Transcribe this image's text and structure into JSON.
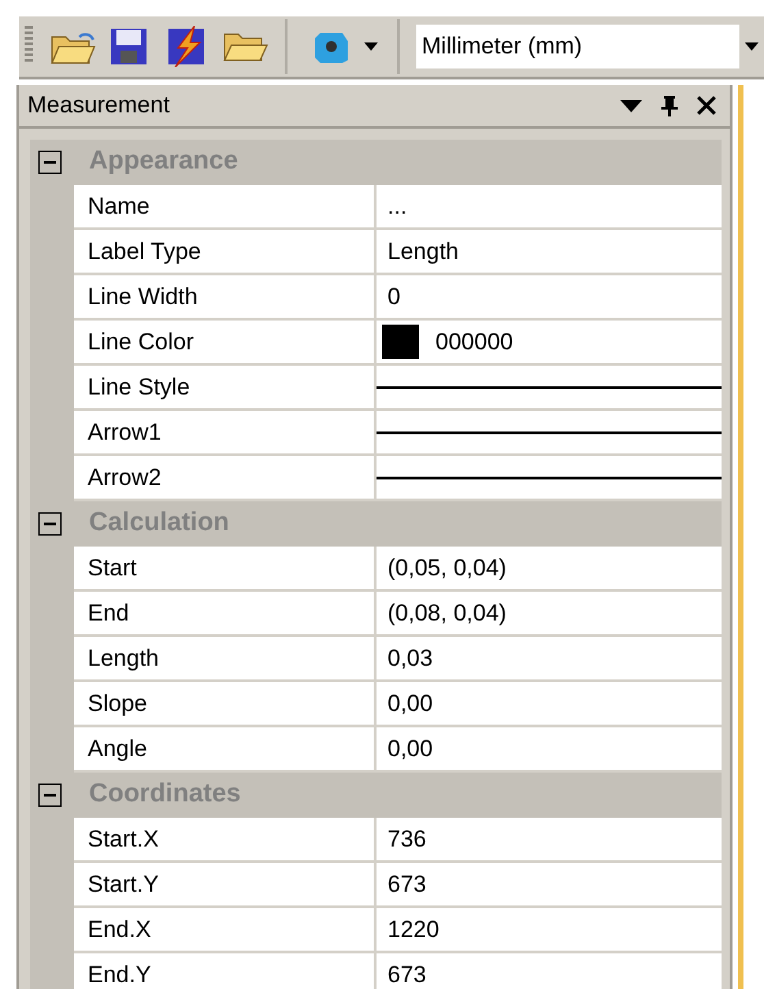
{
  "toolbar": {
    "unit_select": {
      "value": "Millimeter (mm)"
    }
  },
  "panel": {
    "title": "Measurement",
    "categories": [
      {
        "name": "Appearance",
        "expanded": true,
        "rows": [
          {
            "kind": "text",
            "label": "Name",
            "value": "..."
          },
          {
            "kind": "text",
            "label": "Label Type",
            "value": "Length"
          },
          {
            "kind": "text",
            "label": "Line Width",
            "value": "0"
          },
          {
            "kind": "color",
            "label": "Line Color",
            "value": "000000",
            "color": "#000000"
          },
          {
            "kind": "line",
            "label": "Line Style"
          },
          {
            "kind": "line",
            "label": "Arrow1"
          },
          {
            "kind": "line",
            "label": "Arrow2"
          }
        ]
      },
      {
        "name": "Calculation",
        "expanded": true,
        "rows": [
          {
            "kind": "text",
            "label": "Start",
            "value": "(0,05, 0,04)"
          },
          {
            "kind": "text",
            "label": "End",
            "value": "(0,08, 0,04)"
          },
          {
            "kind": "text",
            "label": "Length",
            "value": "0,03"
          },
          {
            "kind": "text",
            "label": "Slope",
            "value": "0,00"
          },
          {
            "kind": "text",
            "label": "Angle",
            "value": "0,00"
          }
        ]
      },
      {
        "name": "Coordinates",
        "expanded": true,
        "rows": [
          {
            "kind": "text",
            "label": "Start.X",
            "value": "736"
          },
          {
            "kind": "text",
            "label": "Start.Y",
            "value": "673"
          },
          {
            "kind": "text",
            "label": "End.X",
            "value": "1220"
          },
          {
            "kind": "text",
            "label": "End.Y",
            "value": "673"
          }
        ]
      }
    ]
  }
}
